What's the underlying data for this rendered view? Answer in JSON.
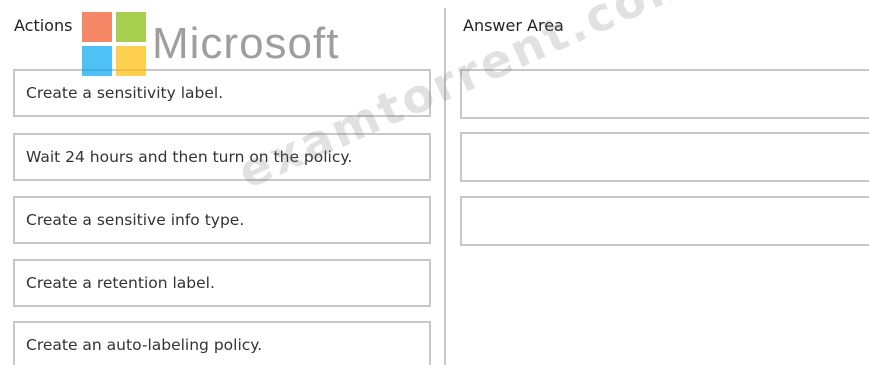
{
  "headers": {
    "actions": "Actions",
    "answer_area": "Answer Area"
  },
  "actions": [
    "Create a sensitivity label.",
    "Wait 24 hours and then turn on the policy.",
    "Create a sensitive info type.",
    "Create a retention label.",
    "Create an auto-labeling policy."
  ],
  "answer_slots": 3,
  "logo": {
    "text": "Microsoft",
    "colors": [
      "#f25022",
      "#7fba00",
      "#00a4ef",
      "#ffb900"
    ]
  },
  "watermark": "examtorrent.com"
}
